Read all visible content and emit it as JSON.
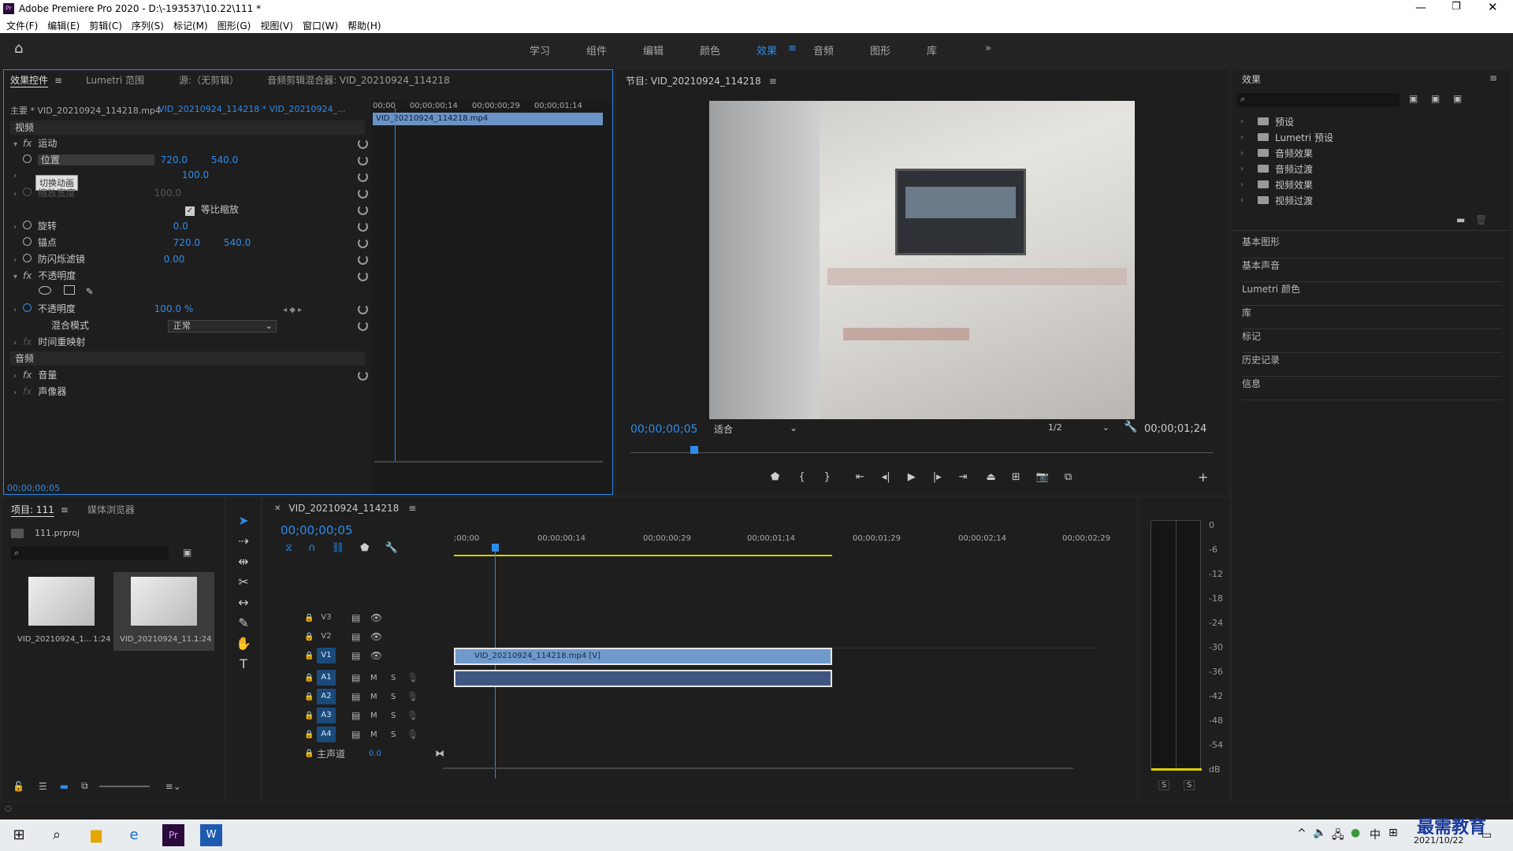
{
  "window": {
    "title": "Adobe Premiere Pro 2020 - D:\\-193537\\10.22\\111 *",
    "app_badge": "Pr"
  },
  "menu": [
    "文件(F)",
    "编辑(E)",
    "剪辑(C)",
    "序列(S)",
    "标记(M)",
    "图形(G)",
    "视图(V)",
    "窗口(W)",
    "帮助(H)"
  ],
  "workspaces": {
    "learn": "学习",
    "assembly": "组件",
    "editing": "编辑",
    "color": "颜色",
    "effects": "效果",
    "audio": "音频",
    "graphics": "图形",
    "libraries": "库",
    "more": "»"
  },
  "effect_controls": {
    "tabs": [
      "效果控件",
      "Lumetri 范围",
      "源:（无剪辑）",
      "音频剪辑混合器: VID_20210924_114218"
    ],
    "master": "主要 * VID_20210924_114218.mp4",
    "sequence": "VID_20210924_114218 * VID_20210924_...",
    "ruler": [
      "00;00",
      "00;00;00;14",
      "00;00;00;29",
      "00;00;01;14"
    ],
    "clip_name": "VID_20210924_114218.mp4",
    "section_video": "视频",
    "motion": "运动",
    "position_label": "位置",
    "position_x": "720.0",
    "position_y": "540.0",
    "tooltip": "切换动画",
    "scale_value": "100.0",
    "scale_width_label": "缩放宽度",
    "scale_width_value": "100.0",
    "uniform_scale": "等比缩放",
    "rotation_label": "旋转",
    "rotation_value": "0.0",
    "anchor_label": "锚点",
    "anchor_x": "720.0",
    "anchor_y": "540.0",
    "flicker_label": "防闪烁滤镜",
    "flicker_value": "0.00",
    "opacity_group": "不透明度",
    "opacity_label": "不透明度",
    "opacity_value": "100.0 %",
    "blend_label": "混合模式",
    "blend_value": "正常",
    "time_remap": "时间重映射",
    "section_audio": "音频",
    "volume": "音量",
    "panner": "声像器",
    "timecode": "00;00;00;05"
  },
  "program": {
    "title": "节目: VID_20210924_114218",
    "timecode": "00;00;00;05",
    "fit": "适合",
    "resolution": "1/2",
    "duration": "00;00;01;24",
    "playhead_fraction": 0.11
  },
  "effects_panel": {
    "title": "效果",
    "folders": [
      "预设",
      "Lumetri 预设",
      "音频效果",
      "音频过渡",
      "视频效果",
      "视频过渡"
    ],
    "sections": [
      "基本图形",
      "基本声音",
      "Lumetri 颜色",
      "库",
      "标记",
      "历史记录",
      "信息"
    ]
  },
  "project": {
    "tabs": [
      "项目: 111",
      "媒体浏览器"
    ],
    "file": "111.prproj",
    "items": [
      {
        "name": "VID_20210924_1...",
        "duration": "1:24"
      },
      {
        "name": "VID_20210924_11...",
        "duration": "1:24"
      }
    ]
  },
  "timeline": {
    "title": "VID_20210924_114218",
    "timecode": "00;00;00;05",
    "ruler": [
      ";00;00",
      "00;00;00;14",
      "00;00;00;29",
      "00;00;01;14",
      "00;00;01;29",
      "00;00;02;14",
      "00;00;02;29"
    ],
    "video_tracks": [
      "V3",
      "V2",
      "V1"
    ],
    "audio_tracks": [
      "A1",
      "A2",
      "A3",
      "A4"
    ],
    "master_label": "主声道",
    "master_value": "0.0",
    "clip_v1": "VID_20210924_114218.mp4 [V]",
    "m": "M",
    "s": "S"
  },
  "audio_meter": {
    "db_scale": [
      "0",
      "-6",
      "-12",
      "-18",
      "-24",
      "-30",
      "-36",
      "-42",
      "-48",
      "-54",
      "dB"
    ],
    "solo_left": "S",
    "solo_right": "S"
  },
  "taskbar": {
    "ime": "中",
    "date": "2021/10/22",
    "watermark": "最需教育"
  }
}
